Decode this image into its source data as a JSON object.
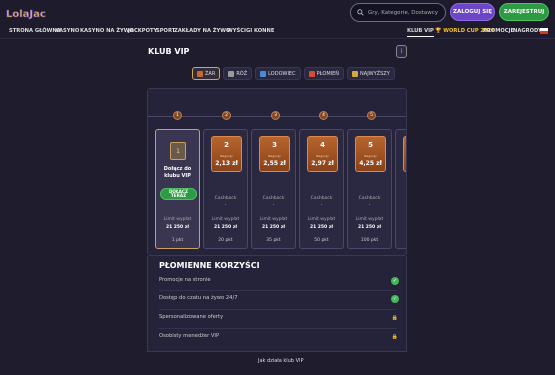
{
  "header": {
    "logo_text": "LolaJack",
    "search_placeholder": "Gry, Kategorie, Dostawcy",
    "login_label": "ZALOGUJ SIĘ",
    "register_label": "ZAREJESTRUJ"
  },
  "nav": {
    "items": [
      "STRONA GŁÓWNA",
      "KASYNO",
      "KASYNO NA ŻYWO",
      "JACKPOTY",
      "SPORT",
      "ZAKŁADY NA ŻYWO",
      "WYŚCIGI KONNE"
    ],
    "right_items": [
      "KLUB VIP",
      "WORLD CUP 2026",
      "PROMOCJE",
      "NAGRODY"
    ]
  },
  "page": {
    "title": "KLUB VIP",
    "tabs": [
      {
        "label": "ŻAR",
        "color": "#c26a30"
      },
      {
        "label": "RÓŻ",
        "color": "#9a9a9a"
      },
      {
        "label": "LODOWIEC",
        "color": "#4a8ad6"
      },
      {
        "label": "PŁOMIEŃ",
        "color": "#d94a30"
      },
      {
        "label": "NAJWYŻSZY",
        "color": "#d4a640"
      }
    ],
    "nodes": [
      "1",
      "2",
      "3",
      "4",
      "5"
    ],
    "first_card": {
      "num": "1",
      "title": "Dołącz do klubu VIP",
      "button": "DOŁĄCZ TERAZ",
      "limit_label": "Limit wypłat",
      "limit_value": "21 250 zł",
      "points": "1 pkt"
    },
    "cards": [
      {
        "num": "2",
        "reward_label": "Nagrody",
        "reward": "2,13 zł",
        "cb_label": "Cashback",
        "cb": "-",
        "limit_label": "Limit wypłat",
        "limit": "21 250 zł",
        "points": "20 pkt"
      },
      {
        "num": "3",
        "reward_label": "Nagrody",
        "reward": "2,55 zł",
        "cb_label": "Cashback",
        "cb": "-",
        "limit_label": "Limit wypłat",
        "limit": "21 250 zł",
        "points": "35 pkt"
      },
      {
        "num": "4",
        "reward_label": "Nagrody",
        "reward": "2,97 zł",
        "cb_label": "Cashback",
        "cb": "-",
        "limit_label": "Limit wypłat",
        "limit": "21 250 zł",
        "points": "50 pkt"
      },
      {
        "num": "5",
        "reward_label": "Nagrody",
        "reward": "4,25 zł",
        "cb_label": "Cashback",
        "cb": "-",
        "limit_label": "Limit wypłat",
        "limit": "21 250 zł",
        "points": "100 pkt"
      }
    ],
    "benefits_title": "PŁOMIENNE KORZYŚCI",
    "benefits": [
      {
        "label": "Promocje na stronie",
        "status": "check"
      },
      {
        "label": "Dostęp do czatu na żywo 24/7",
        "status": "check"
      },
      {
        "label": "Spersonalizowane oferty",
        "status": "lock"
      },
      {
        "label": "Osobisty menedżer VIP",
        "status": "lock"
      }
    ],
    "how_link": "Jak działa klub VIP"
  }
}
